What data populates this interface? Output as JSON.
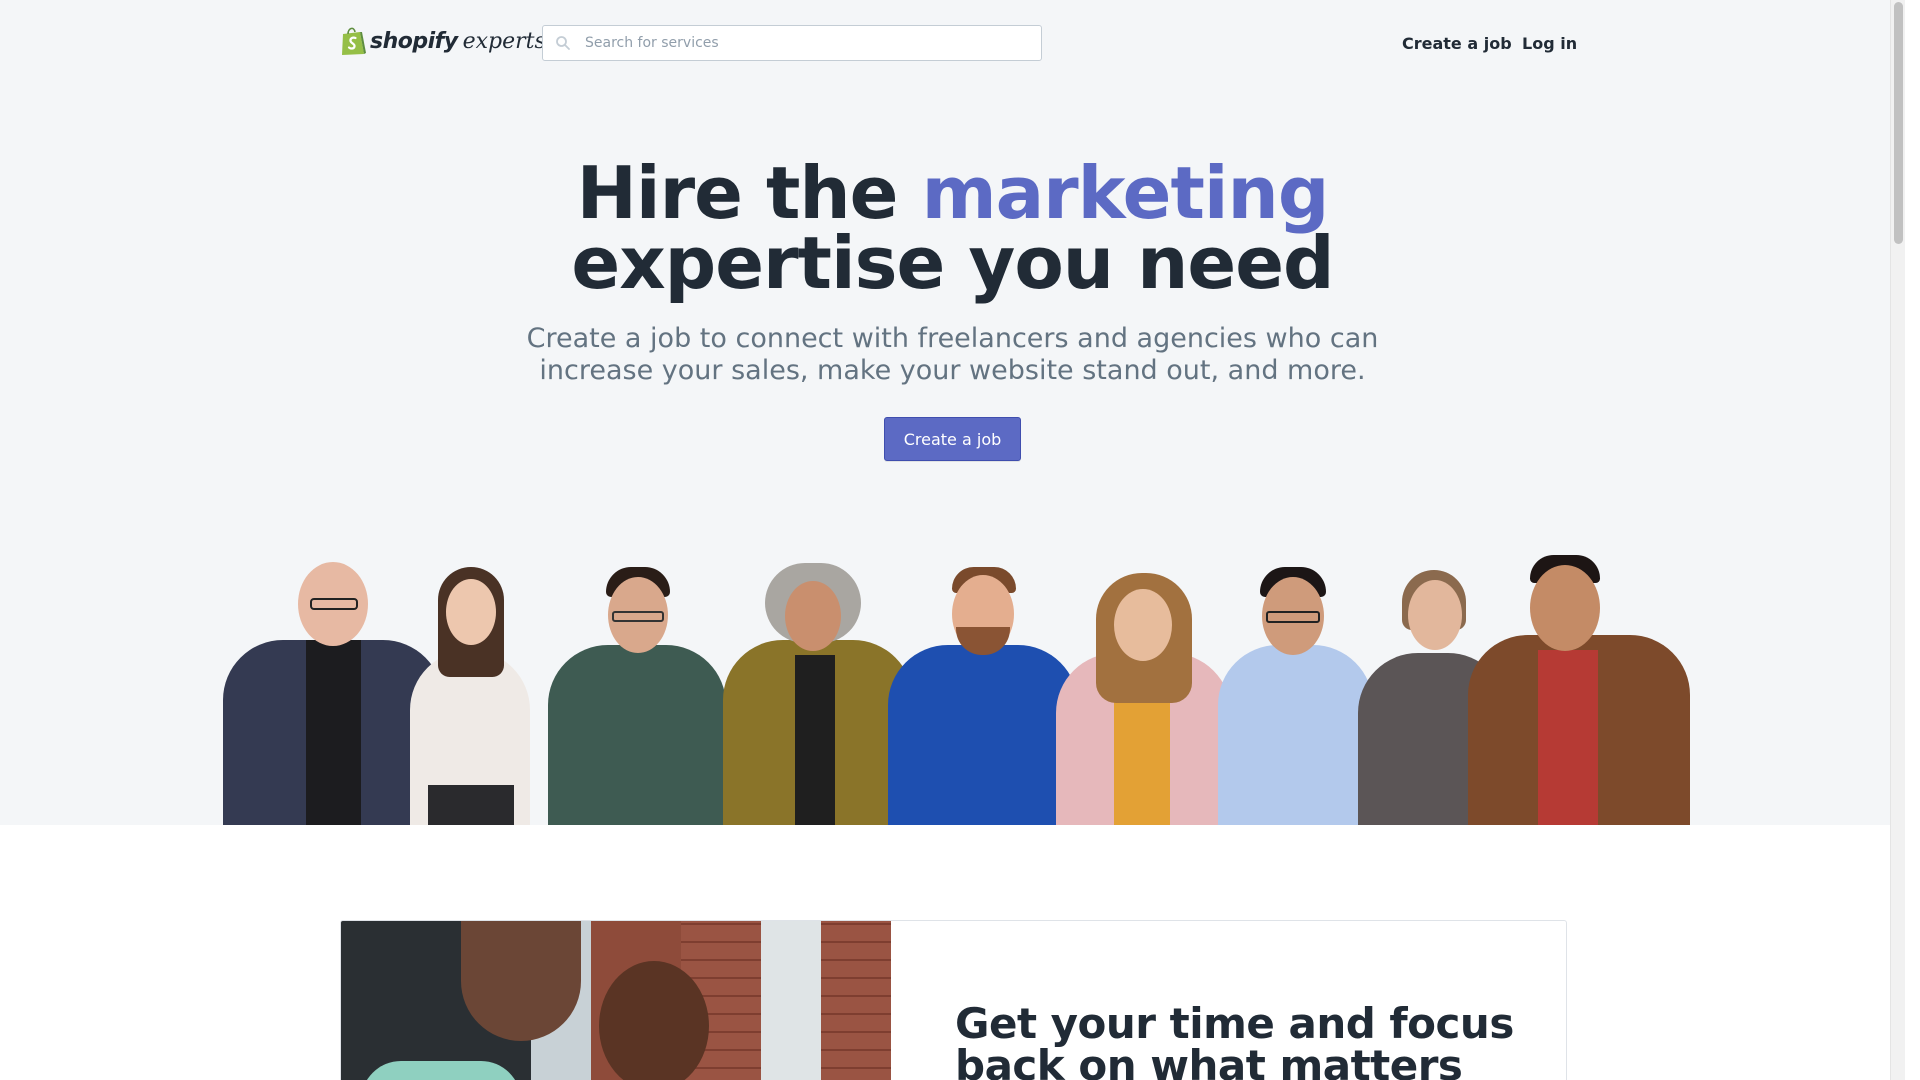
{
  "header": {
    "logo_brand": "shopify",
    "logo_suffix": "experts",
    "search_placeholder": "Search for services",
    "nav": {
      "create_job": "Create a job",
      "log_in": "Log in"
    }
  },
  "hero": {
    "title_prefix": "Hire the ",
    "title_accent": "marketing",
    "title_line2": "expertise you need",
    "subtitle_line1": "Create a job to connect with freelancers and agencies who can",
    "subtitle_line2": "increase your sales, make your website stand out, and more.",
    "cta_label": "Create a job"
  },
  "feature": {
    "title_line1": "Get your time and focus",
    "title_line2": "back on what matters"
  },
  "colors": {
    "accent": "#5c6ac4",
    "hero_bg": "#f4f6f8",
    "text_dark": "#212b36",
    "text_muted": "#637381",
    "logo_green": "#95bf47"
  },
  "icons": {
    "search": "search-icon",
    "logo": "shopify-bag-icon"
  }
}
